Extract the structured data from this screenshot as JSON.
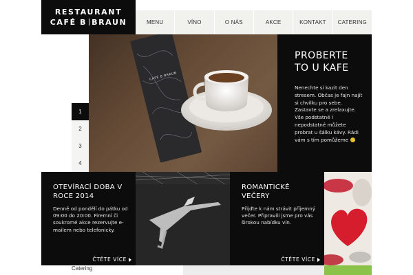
{
  "logo": {
    "line1": "RESTAURANT",
    "line2_left": "CAFÉ B",
    "line2_right": "BRAUN"
  },
  "nav": [
    "MENU",
    "VÍNO",
    "O NÁS",
    "AKCE",
    "KONTAKT",
    "CATERING"
  ],
  "hero": {
    "title": "PROBERTE TO U KAFE",
    "text": "Nenechte si kazit den stresem. Občas je fajn najít si chvilku pro sebe. Zastavte se a zrelaxujte. Vše podstatné i nepodstatné můžete probrat u šálku kávy. Rádi vám s tím pomůžeme",
    "card_brand": "CAFÉ B BRAUN"
  },
  "slider": [
    "1",
    "2",
    "3",
    "4"
  ],
  "cards": [
    {
      "title": "OTEVÍRACÍ DOBA V ROCE 2014",
      "text": "Denně od pondělí do pátku od 09:00 do 20:00. Firemní či soukromé akce rezervujte e-mailem nebo telefonicky.",
      "more": "ČTĚTE VÍCE"
    },
    {
      "title": "ROMANTICKÉ VEČERY",
      "text": "Přijďte k nám strávit příjemný večer. Připravili jsme pro vás širokou nabídku vín.",
      "more": "ČTĚTE VÍCE"
    }
  ],
  "footer": {
    "link": "Catering"
  }
}
